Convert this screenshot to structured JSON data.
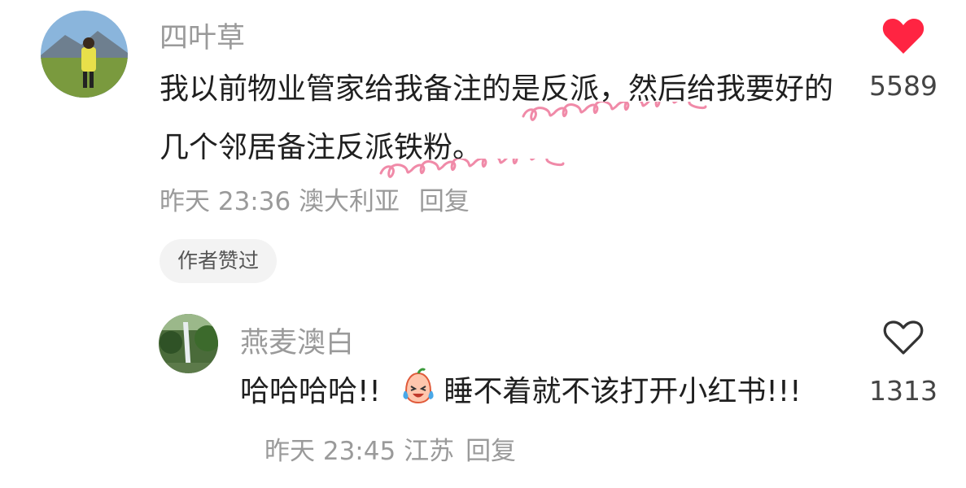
{
  "comment": {
    "author": "四叶草",
    "text": "我以前物业管家给我备注的是反派，然后给我要好的几个邻居备注反派铁粉。",
    "time": "昨天 23:36",
    "location": "澳大利亚",
    "reply_label": "回复",
    "badge": "作者赞过",
    "like_count": "5589",
    "liked": true
  },
  "reply": {
    "author": "燕麦澳白",
    "text_before_emoji": "哈哈哈哈!! ",
    "emoji": "laughing-crying-face-emoji",
    "text_after_emoji": "睡不着就不该打开小红书!!!",
    "time": "昨天 23:45",
    "location": "江苏",
    "reply_label": "回复",
    "like_count": "1313",
    "liked": false
  },
  "colors": {
    "like_red": "#ff2442",
    "squiggle_pink": "#f08aa8",
    "meta_gray": "#9a9a9a"
  }
}
